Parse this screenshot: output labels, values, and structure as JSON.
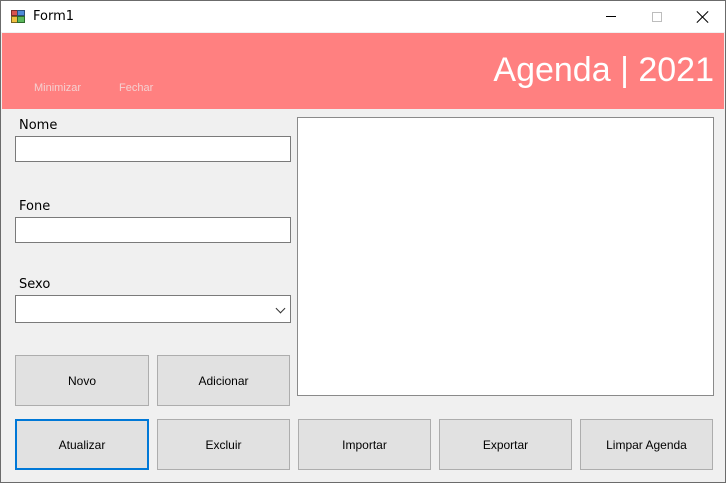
{
  "window": {
    "title": "Form1"
  },
  "header": {
    "minimize_link": "Minimizar",
    "close_link": "Fechar",
    "title": "Agenda | 2021",
    "background": "#ff8080"
  },
  "form": {
    "name_label": "Nome",
    "name_value": "",
    "phone_label": "Fone",
    "phone_value": "",
    "sex_label": "Sexo",
    "sex_value": ""
  },
  "buttons": {
    "novo": "Novo",
    "adicionar": "Adicionar",
    "atualizar": "Atualizar",
    "excluir": "Excluir",
    "importar": "Importar",
    "exportar": "Exportar",
    "limpar": "Limpar Agenda"
  },
  "colors": {
    "focus_border": "#0078d7",
    "button_face": "#e1e1e1"
  }
}
